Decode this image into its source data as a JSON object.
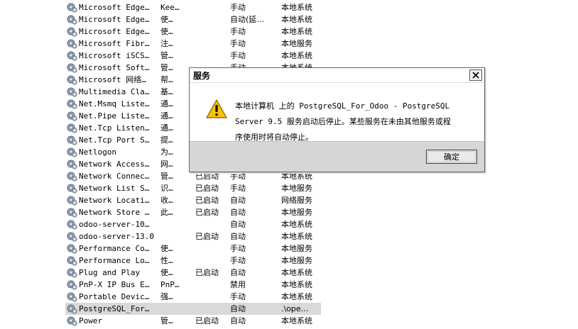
{
  "services": [
    {
      "name": "Microsoft Edge…",
      "desc": "Kee…",
      "status": "",
      "startup": "手动",
      "logon": "本地系统",
      "selected": false
    },
    {
      "name": "Microsoft Edge…",
      "desc": "使…",
      "status": "",
      "startup": "自动(延…",
      "logon": "本地系统",
      "selected": false
    },
    {
      "name": "Microsoft Edge…",
      "desc": "使…",
      "status": "",
      "startup": "手动",
      "logon": "本地系统",
      "selected": false
    },
    {
      "name": "Microsoft Fibr…",
      "desc": "注…",
      "status": "",
      "startup": "手动",
      "logon": "本地服务",
      "selected": false
    },
    {
      "name": "Microsoft iSCS…",
      "desc": "管…",
      "status": "",
      "startup": "手动",
      "logon": "本地系统",
      "selected": false
    },
    {
      "name": "Microsoft Soft…",
      "desc": "管…",
      "status": "",
      "startup": "手动",
      "logon": "本地系统",
      "selected": false
    },
    {
      "name": "Microsoft 网络…",
      "desc": "帮…",
      "status": "",
      "startup": "",
      "logon": "",
      "selected": false
    },
    {
      "name": "Multimedia Cla…",
      "desc": "基…",
      "status": "",
      "startup": "",
      "logon": "",
      "selected": false
    },
    {
      "name": "Net.Msmq Liste…",
      "desc": "通…",
      "status": "",
      "startup": "",
      "logon": "",
      "selected": false
    },
    {
      "name": "Net.Pipe Liste…",
      "desc": "通…",
      "status": "",
      "startup": "",
      "logon": "",
      "selected": false
    },
    {
      "name": "Net.Tcp Listen…",
      "desc": "通…",
      "status": "",
      "startup": "",
      "logon": "",
      "selected": false
    },
    {
      "name": "Net.Tcp Port S…",
      "desc": "提…",
      "status": "",
      "startup": "",
      "logon": "",
      "selected": false
    },
    {
      "name": "Netlogon",
      "desc": "为…",
      "status": "",
      "startup": "",
      "logon": "",
      "selected": false
    },
    {
      "name": "Network Access…",
      "desc": "网…",
      "status": "",
      "startup": "",
      "logon": "",
      "selected": false
    },
    {
      "name": "Network Connec…",
      "desc": "管…",
      "status": "已启动",
      "startup": "手动",
      "logon": "本地系统",
      "selected": false
    },
    {
      "name": "Network List S…",
      "desc": "识…",
      "status": "已启动",
      "startup": "手动",
      "logon": "本地服务",
      "selected": false
    },
    {
      "name": "Network Locati…",
      "desc": "收…",
      "status": "已启动",
      "startup": "自动",
      "logon": "网络服务",
      "selected": false
    },
    {
      "name": "Network Store …",
      "desc": "此…",
      "status": "已启动",
      "startup": "自动",
      "logon": "本地服务",
      "selected": false
    },
    {
      "name": "odoo-server-10…",
      "desc": "",
      "status": "",
      "startup": "自动",
      "logon": "本地系统",
      "selected": false
    },
    {
      "name": "odoo-server-13.0",
      "desc": "",
      "status": "已启动",
      "startup": "自动",
      "logon": "本地系统",
      "selected": false
    },
    {
      "name": "Performance Co…",
      "desc": "使…",
      "status": "",
      "startup": "手动",
      "logon": "本地服务",
      "selected": false
    },
    {
      "name": "Performance Lo…",
      "desc": "性…",
      "status": "",
      "startup": "手动",
      "logon": "本地服务",
      "selected": false
    },
    {
      "name": "Plug and Play",
      "desc": "使…",
      "status": "已启动",
      "startup": "自动",
      "logon": "本地系统",
      "selected": false
    },
    {
      "name": "PnP-X IP Bus E…",
      "desc": "PnP…",
      "status": "",
      "startup": "禁用",
      "logon": "本地系统",
      "selected": false
    },
    {
      "name": "Portable Devic…",
      "desc": "强…",
      "status": "",
      "startup": "手动",
      "logon": "本地系统",
      "selected": false
    },
    {
      "name": "PostgreSQL_For…",
      "desc": "",
      "status": "",
      "startup": "自动",
      "logon": ".\\ope…",
      "selected": true
    },
    {
      "name": "Power",
      "desc": "管…",
      "status": "已启动",
      "startup": "自动",
      "logon": "本地系统",
      "selected": false
    }
  ],
  "dialog": {
    "title": "服务",
    "message_line1": "本地计算机 上的 PostgreSQL_For_Odoo - PostgreSQL",
    "message_line2": "Server 9.5 服务启动后停止。某些服务在未由其他服务或程",
    "message_line3": "序使用时将自动停止。",
    "ok_label": "确定",
    "close_symbol": "✕",
    "icon": "warning-icon"
  },
  "colors": {
    "selected_row": "#d9d9d9",
    "dialog_footer": "#d6d6d6",
    "warning_yellow": "#f5c400"
  }
}
